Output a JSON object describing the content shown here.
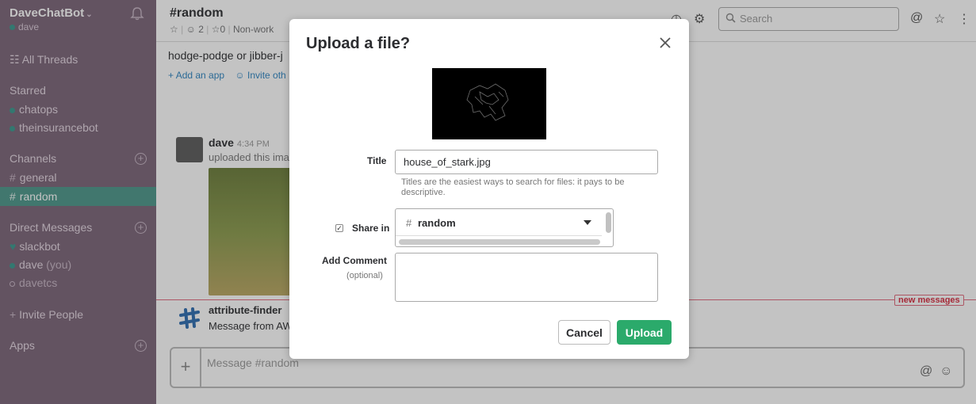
{
  "workspace": {
    "name": "DaveChatBot",
    "user": "dave"
  },
  "sidebar": {
    "all_threads": "All Threads",
    "starred_head": "Starred",
    "starred": [
      "chatops",
      "theinsurancebot"
    ],
    "channels_head": "Channels",
    "channels": [
      "general",
      "random"
    ],
    "dm_head": "Direct Messages",
    "dms": [
      {
        "name": "slackbot",
        "suffix": ""
      },
      {
        "name": "dave",
        "suffix": "(you)"
      },
      {
        "name": "davetcs",
        "suffix": ""
      }
    ],
    "invite": "Invite People",
    "apps": "Apps"
  },
  "channel": {
    "title": "#random",
    "members": "2",
    "pins": "0",
    "topic": "Non-work",
    "purpose": "hodge-podge or jibber-j",
    "add_app": "Add an app",
    "invite": "Invite oth"
  },
  "search": {
    "placeholder": "Search"
  },
  "messages": [
    {
      "author": "dave",
      "time": "4:34 PM",
      "text": "uploaded this ima"
    },
    {
      "author": "attribute-finder",
      "text": "Message from AW"
    }
  ],
  "new_messages": "new messages",
  "composer": {
    "placeholder": "Message #random"
  },
  "modal": {
    "title": "Upload a file?",
    "title_label": "Title",
    "title_value": "house_of_stark.jpg",
    "title_hint": "Titles are the easiest ways to search for files: it pays to be descriptive.",
    "share_label": "Share in",
    "share_checked": true,
    "share_hash": "#",
    "share_value": "random",
    "comment_label": "Add Comment",
    "comment_optional": "(optional)",
    "cancel": "Cancel",
    "upload": "Upload"
  },
  "colors": {
    "sidebar": "#7a6478",
    "selected": "#4c9689",
    "upload": "#2baa6b",
    "new_messages": "#e1687c"
  }
}
